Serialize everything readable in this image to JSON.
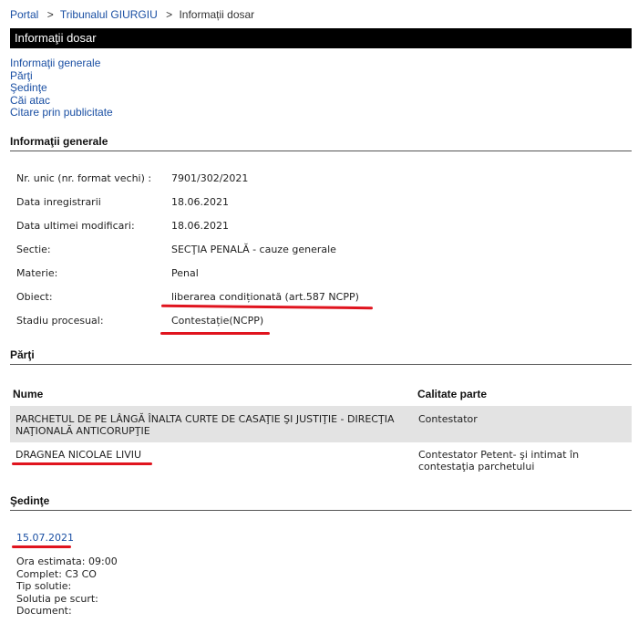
{
  "breadcrumb": {
    "portal": "Portal",
    "court": "Tribunalul GIURGIU",
    "current": "Informații dosar",
    "separator": ">"
  },
  "page_title": "Informaţii dosar",
  "section_nav": [
    "Informaţii generale",
    "Părţi",
    "Şedinţe",
    "Căi atac",
    "Citare prin publicitate"
  ],
  "general_info": {
    "heading": "Informaţii generale",
    "rows": [
      {
        "label": "Nr. unic (nr. format vechi) :",
        "value": "7901/302/2021"
      },
      {
        "label": "Data inregistrarii",
        "value": "18.06.2021"
      },
      {
        "label": "Data ultimei modificari:",
        "value": "18.06.2021"
      },
      {
        "label": "Sectie:",
        "value": "SECŢIA PENALĂ - cauze generale"
      },
      {
        "label": "Materie:",
        "value": "Penal"
      },
      {
        "label": "Obiect:",
        "value": "liberarea condiționată (art.587 NCPP)"
      },
      {
        "label": "Stadiu procesual:",
        "value": "Contestație(NCPP)"
      }
    ]
  },
  "parties": {
    "heading": "Părţi",
    "columns": [
      "Nume",
      "Calitate parte"
    ],
    "rows": [
      {
        "name": "PARCHETUL DE PE LÂNGĂ ÎNALTA CURTE DE CASAŢIE ŞI JUSTIŢIE - DIRECŢIA NAŢIONALĂ ANTICORUPŢIE",
        "role": "Contestator"
      },
      {
        "name": "DRAGNEA NICOLAE LIVIU",
        "role": "Contestator Petent- şi intimat în contestaţia parchetului"
      }
    ]
  },
  "sessions": {
    "heading": "Şedinţe",
    "date": "15.07.2021",
    "details": [
      "Ora estimata: 09:00",
      "Complet: C3 CO",
      "Tip solutie:",
      "Solutia pe scurt:",
      "Document:"
    ]
  },
  "colors": {
    "link": "#1a4fa3",
    "title_bar": "#000000",
    "highlight_row": "#e3e3e3",
    "annotation_underline": "#e0141e"
  }
}
